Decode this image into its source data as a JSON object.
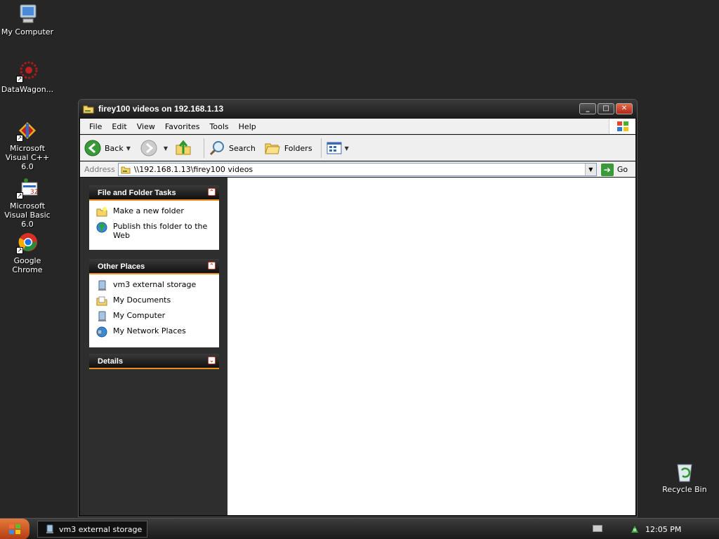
{
  "desktop": {
    "icons": [
      {
        "label": "My Computer"
      },
      {
        "label": "DataWagon..."
      },
      {
        "label": "Microsoft Visual C++ 6.0"
      },
      {
        "label": "Microsoft Visual Basic 6.0"
      },
      {
        "label": "Google Chrome"
      }
    ],
    "recycle_bin": "Recycle Bin"
  },
  "window": {
    "title": "firey100 videos on 192.168.1.13",
    "buttons": {
      "minimize": "_",
      "maximize": "□",
      "close": "✕"
    },
    "menu": [
      "File",
      "Edit",
      "View",
      "Favorites",
      "Tools",
      "Help"
    ],
    "toolbar": {
      "back": "Back",
      "search": "Search",
      "folders": "Folders"
    },
    "address": {
      "label": "Address",
      "value": "\\\\192.168.1.13\\firey100 videos",
      "go": "Go"
    },
    "panels": {
      "file_tasks": {
        "title": "File and Folder Tasks",
        "items": [
          "Make a new folder",
          "Publish this folder to the Web"
        ]
      },
      "other_places": {
        "title": "Other Places",
        "items": [
          "vm3 external storage",
          "My Documents",
          "My Computer",
          "My Network Places"
        ]
      },
      "details": {
        "title": "Details"
      }
    }
  },
  "taskbar": {
    "task": "vm3 external storage",
    "clock": "12:05 PM"
  },
  "colors": {
    "desktop": "#262626",
    "panel_accent": "#e8901c"
  }
}
